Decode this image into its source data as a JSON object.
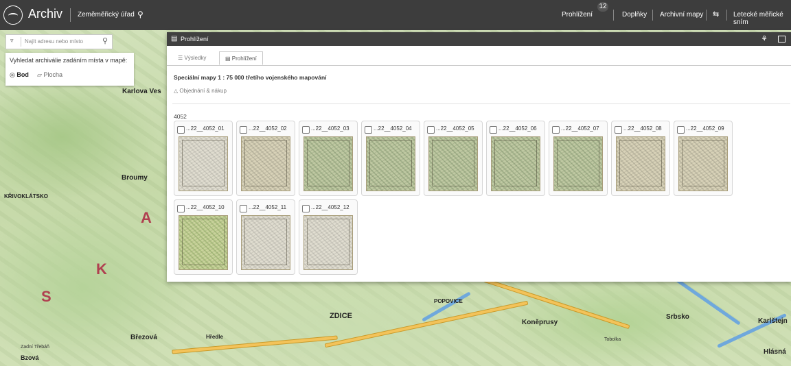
{
  "header": {
    "app_title": "Archiv",
    "organization": "Zeměměřický úřad",
    "nav": [
      {
        "label": "Prohlížení",
        "badge": "12"
      },
      {
        "label": "Doplňky"
      },
      {
        "label": "Archivní mapy"
      },
      {
        "label": "Letecké měřické sním"
      }
    ]
  },
  "search": {
    "placeholder": "Najít adresu nebo místo",
    "filter_title": "Vyhledat archiválie zadáním místa v mapě:",
    "option_bod": "Bod",
    "option_plocha": "Plocha"
  },
  "viewer": {
    "window_title": "Prohlížení",
    "tabs": [
      {
        "label": "Výsledky",
        "active": false
      },
      {
        "label": "Prohlížení",
        "active": true
      }
    ],
    "series_title": "Speciální mapy 1 : 75 000 třetího vojenského mapování",
    "order_link": "Objednání & nákup",
    "group_label": "4052",
    "items": [
      {
        "name": "...22__4052_01",
        "tone": "pale"
      },
      {
        "name": "...22__4052_02",
        "tone": "default"
      },
      {
        "name": "...22__4052_03",
        "tone": "green"
      },
      {
        "name": "...22__4052_04",
        "tone": "green"
      },
      {
        "name": "...22__4052_05",
        "tone": "green"
      },
      {
        "name": "...22__4052_06",
        "tone": "green"
      },
      {
        "name": "...22__4052_07",
        "tone": "green"
      },
      {
        "name": "...22__4052_08",
        "tone": "default"
      },
      {
        "name": "...22__4052_09",
        "tone": "default"
      },
      {
        "name": "...22__4052_10",
        "tone": "lime"
      },
      {
        "name": "...22__4052_11",
        "tone": "pale"
      },
      {
        "name": "...22__4052_12",
        "tone": "pale"
      }
    ]
  },
  "map_labels": [
    "Karlova Ves",
    "Broumy",
    "KŘIVOKLÁTSKO",
    "ZDICE",
    "Koněprusy",
    "Srbsko",
    "Karlštejn",
    "Březová",
    "Hředle",
    "POPOVICE",
    "Hlásná",
    "Tobolka",
    "Zadní Třebáň",
    "Bzová"
  ],
  "colors": {
    "topbar": "#3d3d3d",
    "window_header": "#404040"
  }
}
